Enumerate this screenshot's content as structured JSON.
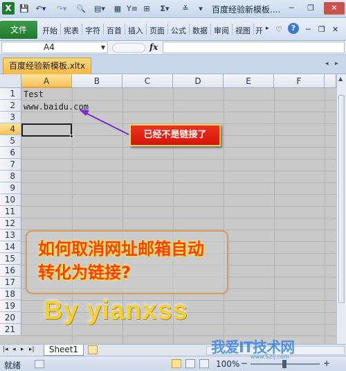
{
  "window": {
    "title": "百度经验新模板....",
    "buttons": [
      "▾",
      "?",
      "▭",
      "▣",
      "✕"
    ]
  },
  "qat": {
    "sigma": "Σ"
  },
  "ribbon": {
    "file_tab": "文件",
    "tabs": [
      "开始",
      "宪表",
      "字符",
      "百首",
      "插入",
      "页面",
      "公式",
      "数据",
      "审阅",
      "视图",
      "开"
    ]
  },
  "formula_bar": {
    "name_box": "A4",
    "fx": "fx",
    "value": ""
  },
  "workbook_tab": "百度经验新模板.xltx",
  "grid": {
    "columns": [
      "A",
      "B",
      "C",
      "D",
      "E",
      "F"
    ],
    "rows": [
      "1",
      "2",
      "3",
      "4",
      "5",
      "6",
      "7",
      "8",
      "9",
      "10",
      "11",
      "12",
      "13",
      "14",
      "15",
      "16",
      "17",
      "18",
      "19",
      "20",
      "21"
    ],
    "selected_column": "A",
    "selected_row": "4",
    "cells": {
      "A1": "Test",
      "A2": "www.baidu.com"
    }
  },
  "annotations": {
    "callout": "已经不是链接了",
    "big_text_line1": "如何取消网址邮箱自动",
    "big_text_line2": "转化为链接?",
    "signature": "By  yianxss"
  },
  "sheets": {
    "tab": "Sheet1"
  },
  "status": {
    "ready": "就绪",
    "zoom": "100%",
    "minus": "−",
    "plus": "+"
  },
  "watermark": {
    "main": "我爱IT技术网",
    "sub": "www.52ij.com"
  },
  "colors": {
    "accent_green": "#1f7a2e",
    "callout_red": "#e2220f",
    "selected_header": "#f5c25a"
  }
}
